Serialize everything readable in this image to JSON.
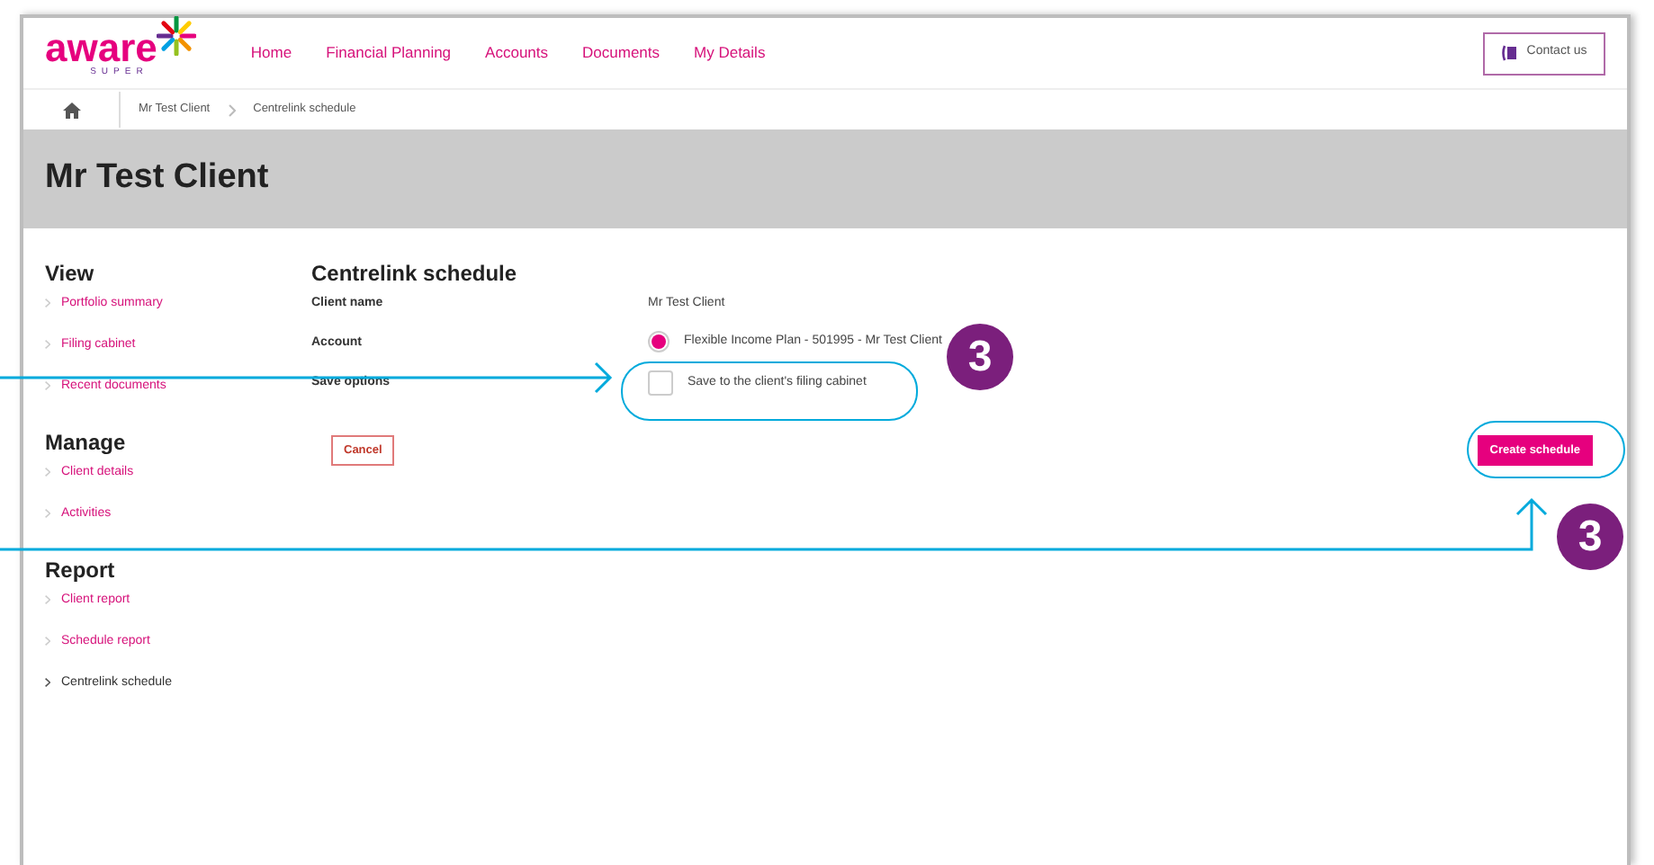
{
  "logo": {
    "word": "aware",
    "sub": "SUPER"
  },
  "nav": [
    {
      "label": "Home"
    },
    {
      "label": "Financial Planning"
    },
    {
      "label": "Accounts"
    },
    {
      "label": "Documents"
    },
    {
      "label": "My Details"
    }
  ],
  "contact_button": "Contact us",
  "breadcrumb": [
    "Mr Test Client",
    "Centrelink schedule"
  ],
  "page_title": "Mr Test Client",
  "sidebar": [
    {
      "heading": "View",
      "items": [
        {
          "label": "Portfolio summary",
          "selected": false
        },
        {
          "label": "Filing cabinet",
          "selected": false
        },
        {
          "label": "Recent documents",
          "selected": false
        }
      ]
    },
    {
      "heading": "Manage",
      "items": [
        {
          "label": "Client details",
          "selected": false
        },
        {
          "label": "Activities",
          "selected": false
        }
      ]
    },
    {
      "heading": "Report",
      "items": [
        {
          "label": "Client report",
          "selected": false
        },
        {
          "label": "Schedule report",
          "selected": false
        },
        {
          "label": "Centrelink schedule",
          "selected": true
        }
      ]
    }
  ],
  "form": {
    "title": "Centrelink schedule",
    "rows": [
      {
        "kind": "text",
        "label": "Client name",
        "value": "Mr Test Client"
      },
      {
        "kind": "radio",
        "label": "Account",
        "value": "Flexible Income Plan - 501995 - Mr Test Client",
        "selected": true
      },
      {
        "kind": "checkbox",
        "label": "Save options",
        "value": "Save to the client's filing cabinet",
        "checked": false
      }
    ],
    "cancel": "Cancel",
    "submit": "Create schedule"
  },
  "callouts": [
    {
      "number": "3"
    },
    {
      "number": "3"
    }
  ]
}
